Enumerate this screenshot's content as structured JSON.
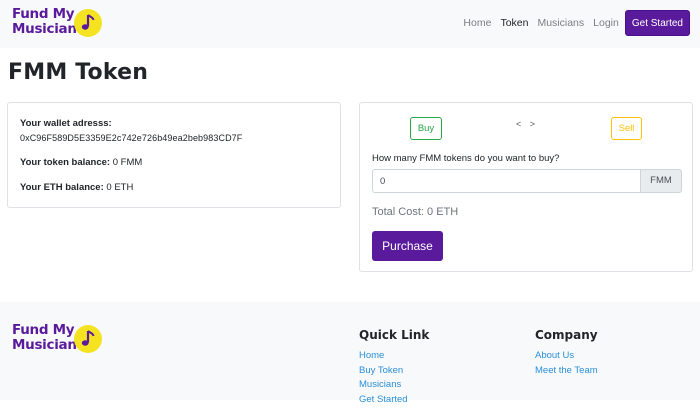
{
  "navbar": {
    "brand": {
      "line1": "Fund My",
      "line2": "Musician",
      "logo_icon": "music-note-icon",
      "logo_color": "#f5e322"
    },
    "links": [
      {
        "label": "Home"
      },
      {
        "label": "Token"
      },
      {
        "label": "Musicians"
      },
      {
        "label": "Login"
      }
    ],
    "cta_label": "Get Started"
  },
  "page": {
    "title": "FMM Token"
  },
  "wallet": {
    "address_label": "Your wallet adresss:",
    "address": "0xC96F589D5E3359E2c742e726b49ea2beb983CD7F",
    "token_balance_label": "Your token balance:",
    "token_balance_value": " 0 FMM",
    "eth_balance_label": "Your ETH balance:",
    "eth_balance_value": " 0 ETH"
  },
  "trade": {
    "buy_label": "Buy",
    "arrows": "< >",
    "sell_label": "Sell",
    "question": "How many FMM tokens do you want to buy?",
    "amount_value": "0",
    "suffix": "FMM",
    "total_cost": "Total Cost: 0 ETH",
    "purchase_label": "Purchase"
  },
  "footer": {
    "brand": {
      "line1": "Fund My",
      "line2": "Musician"
    },
    "quick_link": {
      "heading": "Quick Link",
      "links": [
        {
          "label": "Home"
        },
        {
          "label": "Buy Token"
        },
        {
          "label": "Musicians"
        },
        {
          "label": "Get Started"
        }
      ]
    },
    "company": {
      "heading": "Company",
      "links": [
        {
          "label": "About Us"
        },
        {
          "label": "Meet the Team"
        }
      ]
    }
  },
  "colors": {
    "brand_purple": "#5a1a9c",
    "logo_yellow": "#f5e322",
    "buy_green": "#28a745",
    "sell_yellow": "#ffc107",
    "link_blue": "#2a8fd8"
  }
}
